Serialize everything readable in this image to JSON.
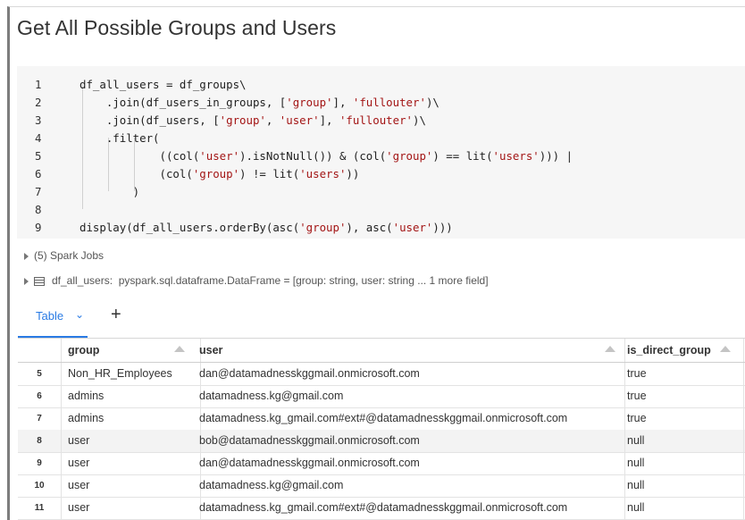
{
  "cell_title": "Get All Possible Groups and Users",
  "code": {
    "lines": [
      {
        "n": "1",
        "text": "df_all_users = df_groups\\"
      },
      {
        "n": "2",
        "text": "    .join(df_users_in_groups, ['group'], 'fullouter')\\"
      },
      {
        "n": "3",
        "text": "    .join(df_users, ['group', 'user'], 'fullouter')\\"
      },
      {
        "n": "4",
        "text": "    .filter("
      },
      {
        "n": "5",
        "text": "            ((col('user').isNotNull()) & (col('group') == lit('users'))) |"
      },
      {
        "n": "6",
        "text": "            (col('group') != lit('users'))"
      },
      {
        "n": "7",
        "text": "        )"
      },
      {
        "n": "8",
        "text": ""
      },
      {
        "n": "9",
        "text": "display(df_all_users.orderBy(asc('group'), asc('user')))"
      }
    ]
  },
  "spark_jobs": "(5) Spark Jobs",
  "dataframe_info": {
    "name": "df_all_users:",
    "schema": "pyspark.sql.dataframe.DataFrame = [group: string, user: string ... 1 more field]"
  },
  "tabs": {
    "table_label": "Table",
    "chevron_icon": "chevron-down-icon",
    "add_icon": "plus-icon"
  },
  "table": {
    "columns": [
      "group",
      "user",
      "is_direct_group"
    ],
    "rows": [
      {
        "index": "5",
        "group": "Non_HR_Employees",
        "user": "dan@datamadnesskggmail.onmicrosoft.com",
        "is_direct_group": "true"
      },
      {
        "index": "6",
        "group": "admins",
        "user": "datamadness.kg@gmail.com",
        "is_direct_group": "true"
      },
      {
        "index": "7",
        "group": "admins",
        "user": "datamadness.kg_gmail.com#ext#@datamadnesskggmail.onmicrosoft.com",
        "is_direct_group": "true"
      },
      {
        "index": "8",
        "group": "user",
        "user": "bob@datamadnesskggmail.onmicrosoft.com",
        "is_direct_group": "null"
      },
      {
        "index": "9",
        "group": "user",
        "user": "dan@datamadnesskggmail.onmicrosoft.com",
        "is_direct_group": "null"
      },
      {
        "index": "10",
        "group": "user",
        "user": "datamadness.kg@gmail.com",
        "is_direct_group": "null"
      },
      {
        "index": "11",
        "group": "user",
        "user": "datamadness.kg_gmail.com#ext#@datamadnesskggmail.onmicrosoft.com",
        "is_direct_group": "null"
      }
    ]
  },
  "colors": {
    "accent": "#2a7be4",
    "string": "#a31515",
    "code_bg": "#f6f6f6"
  }
}
